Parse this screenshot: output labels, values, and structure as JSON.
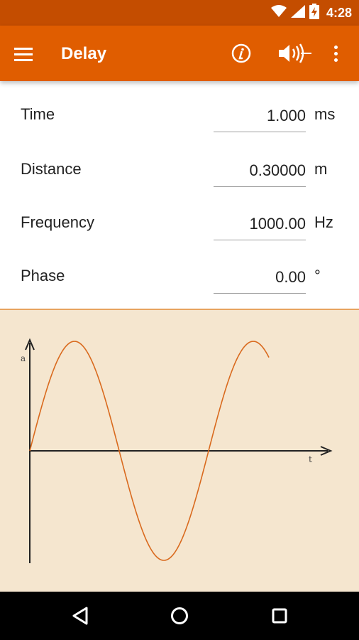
{
  "status_bar": {
    "time": "4:28",
    "icons": [
      "wifi-icon",
      "signal-icon",
      "battery-charging-icon"
    ]
  },
  "app_bar": {
    "title": "Delay",
    "icons": [
      "menu-icon",
      "info-icon",
      "speaker-icon",
      "more-vert-icon"
    ]
  },
  "fields": [
    {
      "label": "Time",
      "value": "1.000",
      "unit": "ms"
    },
    {
      "label": "Distance",
      "value": "0.30000",
      "unit": "m"
    },
    {
      "label": "Frequency",
      "value": "1000.00",
      "unit": "Hz"
    },
    {
      "label": "Phase",
      "value": "0.00",
      "unit": "°"
    }
  ],
  "plot": {
    "y_axis_label": "a",
    "x_axis_label": "t"
  },
  "nav_bar": {
    "icons": [
      "back-icon",
      "home-icon",
      "recents-icon"
    ]
  },
  "colors": {
    "status_bar": "#c44d00",
    "app_bar": "#e05d00",
    "plot_background": "#f5e6cf",
    "wave": "#d96a1e"
  }
}
